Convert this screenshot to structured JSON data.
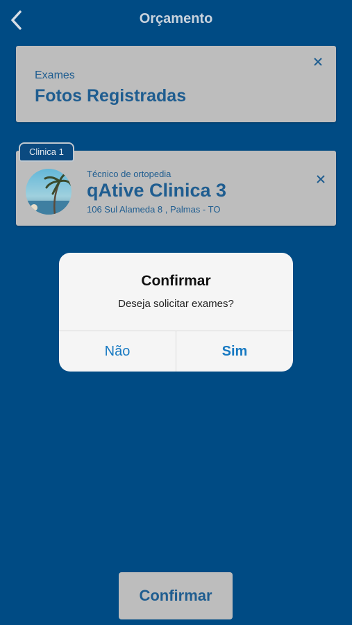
{
  "header": {
    "title": "Orçamento",
    "back_icon": "chevron-left-icon"
  },
  "exam_card": {
    "label": "Exames",
    "value": "Fotos Registradas",
    "close_icon": "close-icon"
  },
  "clinic_card": {
    "tag": "Clinica 1",
    "specialty": "Técnico de ortopedia",
    "name": "qAtive Clinica 3",
    "address": "106 Sul Alameda 8 , Palmas - TO",
    "close_icon": "close-icon"
  },
  "dialog": {
    "title": "Confirmar",
    "message": "Deseja solicitar exames?",
    "no_label": "Não",
    "yes_label": "Sim"
  },
  "footer": {
    "confirm_label": "Confirmar"
  },
  "colors": {
    "background": "#004b84",
    "card": "#bdbdbd",
    "text_blue": "#1f5d90",
    "dialog_button": "#1779c2"
  }
}
